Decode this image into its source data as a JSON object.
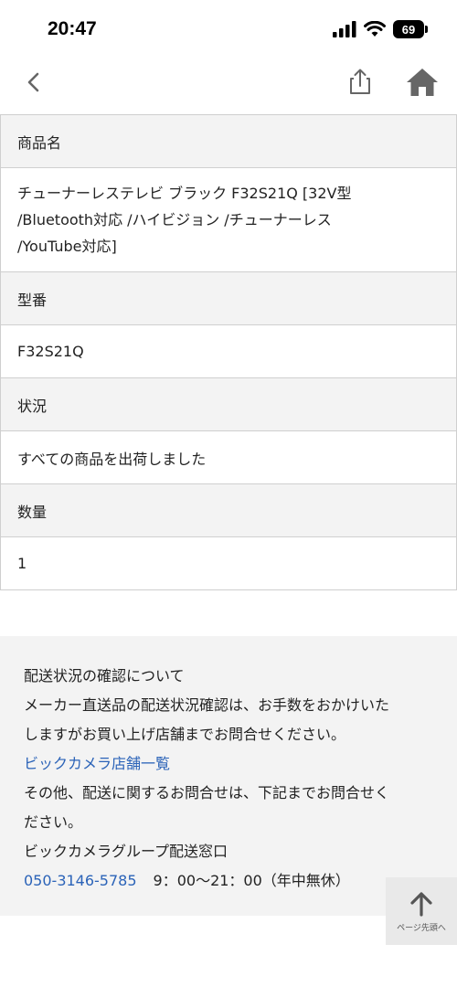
{
  "status_bar": {
    "time": "20:47",
    "battery": "69"
  },
  "nav": {
    "back_icon": "chevron-left-icon",
    "share_icon": "share-icon",
    "home_icon": "home-icon"
  },
  "table": [
    {
      "label": "商品名",
      "value_lines": [
        "チューナーレステレビ ブラック F32S21Q [32V型",
        "/Bluetooth対応 /ハイビジョン /チューナーレス",
        "/YouTube対応]"
      ]
    },
    {
      "label": "型番",
      "value": "F32S21Q"
    },
    {
      "label": "状況",
      "value": "すべての商品を出荷しました"
    },
    {
      "label": "数量",
      "value": "1"
    }
  ],
  "info": {
    "heading": "配送状況の確認について",
    "text1_line1": "メーカー直送品の配送状況確認は、お手数をおかけいた",
    "text1_line2": "しますがお買い上げ店舗までお問合せください。",
    "store_link": "ビックカメラ店舗一覧",
    "text2_line1": "その他、配送に関するお問合せは、下記までお問合せく",
    "text2_line2": "ださい。",
    "contact_name": "ビックカメラグループ配送窓口",
    "phone": "050-3146-5785",
    "hours": "9：00〜21：00（年中無休）"
  },
  "page_top": {
    "label": "ページ先頭へ",
    "icon": "arrow-up-icon"
  },
  "colors": {
    "link": "#2b63b8",
    "label_bg": "#f3f3f3",
    "border": "#cfcfcf"
  }
}
